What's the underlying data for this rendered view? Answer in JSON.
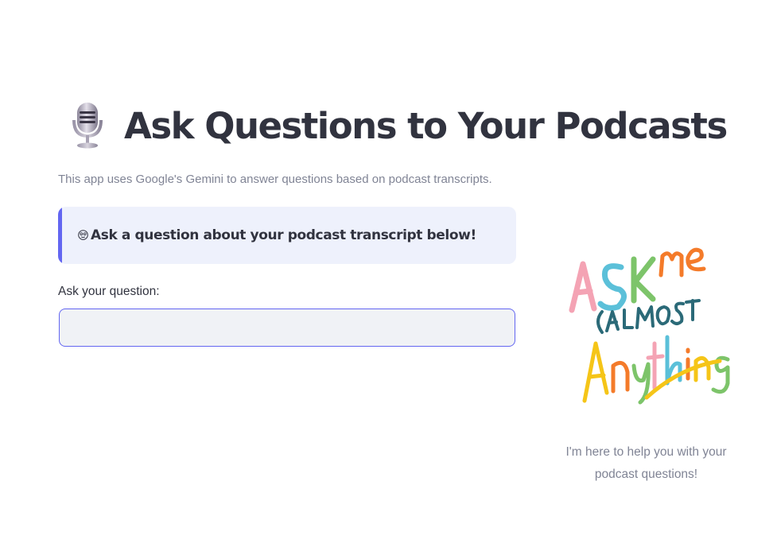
{
  "header": {
    "icon": "microphone-icon",
    "title": "Ask Questions to Your Podcasts"
  },
  "subtitle": "This app uses Google's Gemini to answer questions based on podcast transcripts.",
  "info_box": {
    "icon": "face-with-monocle-icon",
    "text": "Ask a question about your podcast transcript below!",
    "accent_color": "#6366f1",
    "background": "#eef1fc"
  },
  "question_field": {
    "label": "Ask your question:",
    "value": "",
    "placeholder": ""
  },
  "side_panel": {
    "image_text": "ASK me (ALMOST Anything",
    "caption": "I'm here to help you with your podcast questions!"
  },
  "colors": {
    "text": "#31333f",
    "muted": "#808495",
    "input_bg": "#f0f2f6"
  }
}
